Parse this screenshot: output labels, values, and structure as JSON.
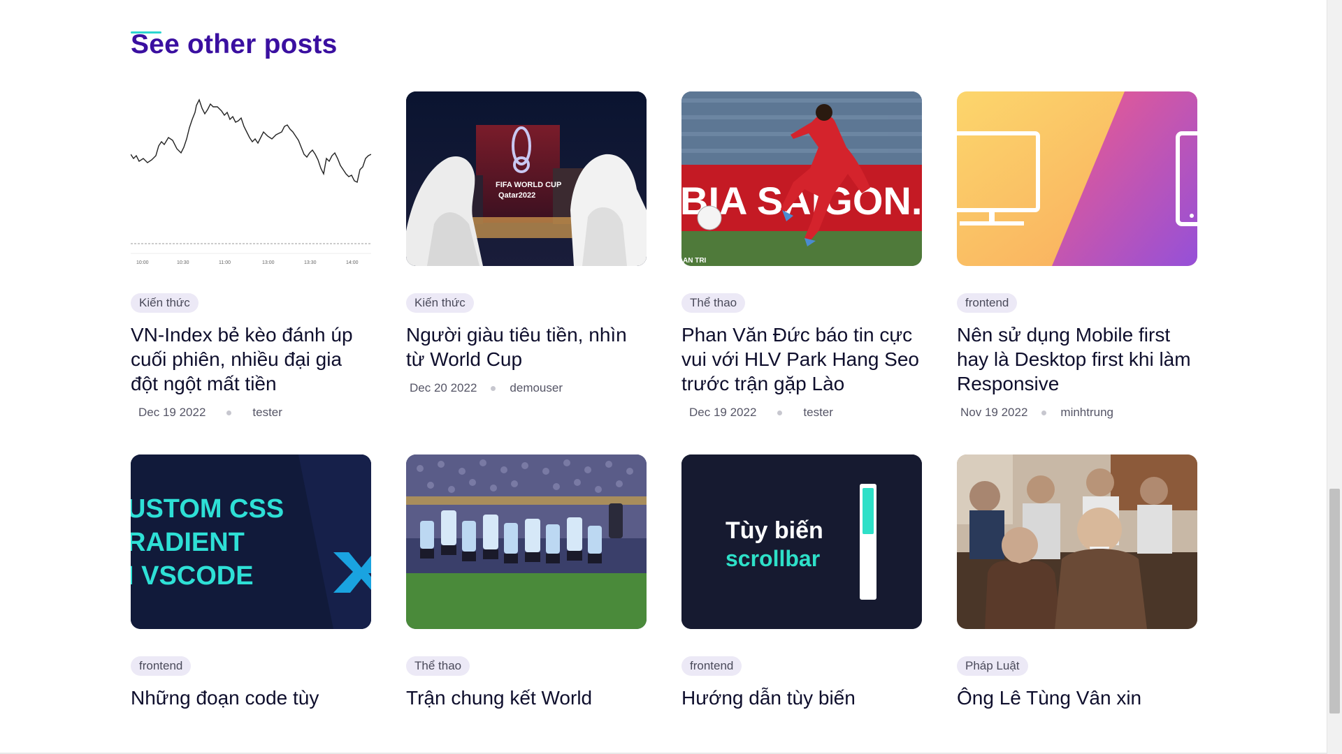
{
  "section": {
    "title": "See other posts"
  },
  "posts": [
    {
      "tag": "Kiến thức",
      "title": "VN-Index bẻ kèo đánh úp cuối phiên, nhiều đại gia đột ngột mất tiền",
      "date": "Dec 19 2022",
      "author": "tester",
      "thumb_axis": [
        "10:00",
        "10:30",
        "11:00",
        "13:00",
        "13:30",
        "14:00"
      ]
    },
    {
      "tag": "Kiến thức",
      "title": "Người giàu tiêu tiền, nhìn từ World Cup",
      "date": "Dec 20 2022",
      "author": "demouser",
      "thumb_caption_1": "FIFA WORLD CUP",
      "thumb_caption_2": "Qatar2022"
    },
    {
      "tag": "Thể thao",
      "title": "Phan Văn Đức báo tin cực vui với HLV Park Hang Seo trước trận gặp Lào",
      "date": "Dec 19 2022",
      "author": "tester",
      "thumb_caption_1": "BIA SAIGON.",
      "thumb_caption_2": "AN TRI"
    },
    {
      "tag": "frontend",
      "title": "Nên sử dụng Mobile first hay là Desktop first khi làm Responsive",
      "date": "Nov 19 2022",
      "author": "minhtrung"
    },
    {
      "tag": "frontend",
      "title": "Những đoạn code tùy",
      "thumb_caption_1": "USTOM CSS",
      "thumb_caption_2": "RADIENT",
      "thumb_caption_3": "I VSCODE"
    },
    {
      "tag": "Thể thao",
      "title": "Trận chung kết World"
    },
    {
      "tag": "frontend",
      "title": "Hướng dẫn tùy biến",
      "thumb_caption_1": "Tùy biến",
      "thumb_caption_2": "scrollbar"
    },
    {
      "tag": "Pháp Luật",
      "title": "Ông Lê Tùng Vân xin"
    }
  ],
  "colors": {
    "title": "#3a0fa0",
    "accent": "#2cd5d0",
    "tag_bg": "#ece9f6"
  }
}
